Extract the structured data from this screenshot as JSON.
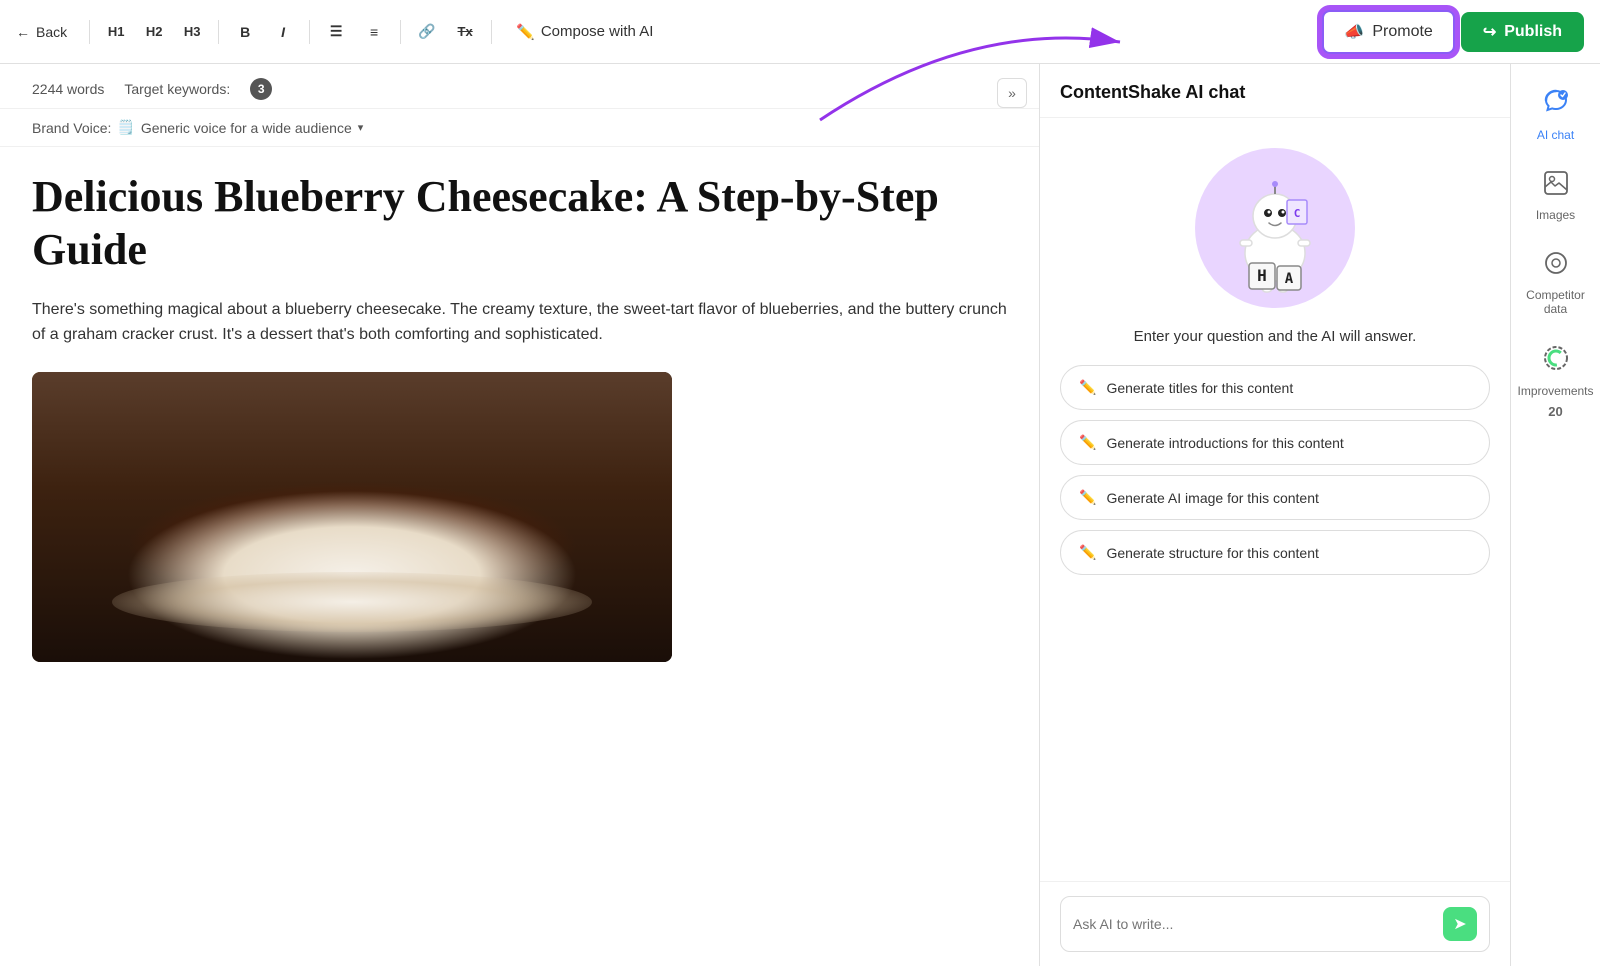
{
  "toolbar": {
    "back_label": "Back",
    "h1_label": "H1",
    "h2_label": "H2",
    "h3_label": "H3",
    "bold_label": "B",
    "italic_label": "I",
    "ol_label": "≡",
    "ul_label": "≡",
    "link_label": "🔗",
    "clear_label": "Tx",
    "compose_label": "Compose with AI",
    "promote_label": "Promote",
    "publish_label": "Publish"
  },
  "editor": {
    "word_count": "2244 words",
    "target_keywords_label": "Target keywords:",
    "keyword_count": "3",
    "brand_voice_label": "Brand Voice:",
    "brand_voice_icon": "🗒️",
    "brand_voice_value": "Generic voice for a wide audience",
    "title": "Delicious Blueberry Cheesecake: A Step-by-Step Guide",
    "intro": "There's something magical about a blueberry cheesecake. The creamy texture, the sweet-tart flavor of blueberries, and the buttery crunch of a graham cracker crust. It's a dessert that's both comforting and sophisticated."
  },
  "ai_panel": {
    "header": "ContentShake AI chat",
    "prompt_text": "Enter your question and the AI will answer.",
    "actions": [
      {
        "id": "titles",
        "label": "Generate titles for this content"
      },
      {
        "id": "introductions",
        "label": "Generate introductions for this content"
      },
      {
        "id": "ai_image",
        "label": "Generate AI image for this content"
      },
      {
        "id": "structure",
        "label": "Generate structure for this content"
      }
    ],
    "input_placeholder": "Ask AI to write..."
  },
  "sidebar": {
    "items": [
      {
        "id": "ai-chat",
        "icon": "💬",
        "label": "AI chat",
        "active": true
      },
      {
        "id": "images",
        "icon": "🖼",
        "label": "Images",
        "active": false
      },
      {
        "id": "competitor-data",
        "icon": "🔍",
        "label": "Competitor data",
        "active": false
      },
      {
        "id": "improvements",
        "icon": "improvements",
        "label": "Improvements",
        "badge": "20",
        "active": false
      }
    ]
  }
}
